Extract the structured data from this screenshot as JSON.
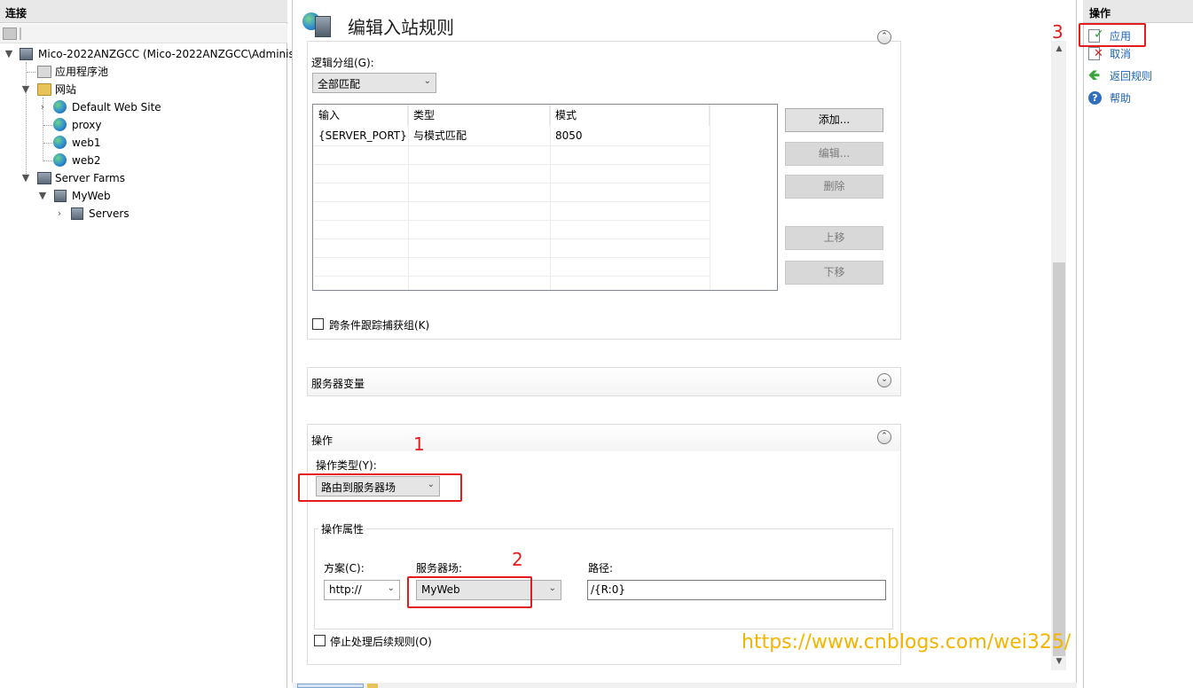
{
  "left_pane": {
    "header": "连接",
    "tree": {
      "server": "Mico-2022ANZGCC (Mico-2022ANZGCC\\Adminis",
      "app_pools": "应用程序池",
      "sites": "网站",
      "site_items": [
        "Default Web Site",
        "proxy",
        "web1",
        "web2"
      ],
      "server_farms": "Server Farms",
      "farm": "MyWeb",
      "servers": "Servers"
    }
  },
  "main": {
    "title": "编辑入站规则",
    "conditions": {
      "logical_group_label": "逻辑分组(G):",
      "logical_group_value": "全部匹配",
      "columns": [
        "输入",
        "类型",
        "模式"
      ],
      "rows": [
        [
          "{SERVER_PORT}",
          "与模式匹配",
          "8050"
        ]
      ],
      "buttons": {
        "add": "添加...",
        "edit": "编辑...",
        "delete": "删除",
        "move_up": "上移",
        "move_down": "下移"
      },
      "track_groups_label": "跨条件跟踪捕获组(K)"
    },
    "server_variables": {
      "title": "服务器变量"
    },
    "action": {
      "title": "操作",
      "type_label": "操作类型(Y):",
      "type_value": "路由到服务器场",
      "properties_title": "操作属性",
      "scheme_label": "方案(C):",
      "scheme_value": "http://",
      "farm_label": "服务器场:",
      "farm_value": "MyWeb",
      "path_label": "路径:",
      "path_value": "/{R:0}",
      "stop_label": "停止处理后续规则(O)"
    }
  },
  "right_pane": {
    "header": "操作",
    "actions": {
      "apply": "应用",
      "cancel": "取消",
      "back": "返回规则",
      "help": "帮助"
    }
  },
  "annotations": {
    "n1": "1",
    "n2": "2",
    "n3": "3",
    "watermark": "https://www.cnblogs.com/wei325/"
  },
  "colors": {
    "annotation_red": "#e51c1c",
    "watermark_yellow": "#f4b400",
    "link_blue": "#1e62b0"
  }
}
